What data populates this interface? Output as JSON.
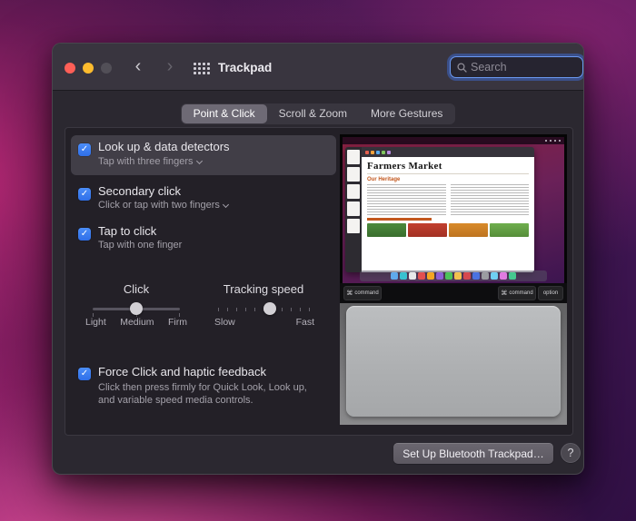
{
  "titlebar": {
    "title": "Trackpad",
    "search_placeholder": "Search"
  },
  "icons": {
    "back": "‹",
    "forward": "›",
    "check": "✓",
    "command_symbol": "⌘"
  },
  "tabs": [
    {
      "label": "Point & Click",
      "selected": true
    },
    {
      "label": "Scroll & Zoom",
      "selected": false
    },
    {
      "label": "More Gestures",
      "selected": false
    }
  ],
  "settings": [
    {
      "label": "Look up & data detectors",
      "detail": "Tap with three fingers",
      "checked": true,
      "has_dropdown": true
    },
    {
      "label": "Secondary click",
      "detail": "Click or tap with two fingers",
      "checked": true,
      "has_dropdown": true
    },
    {
      "label": "Tap to click",
      "detail": "Tap with one finger",
      "checked": true,
      "has_dropdown": false
    },
    {
      "label": "Force Click and haptic feedback",
      "detail": "Click then press firmly for Quick Look, Look up, and variable speed media controls.",
      "checked": true,
      "has_dropdown": false
    }
  ],
  "sliders": {
    "click": {
      "label": "Click",
      "ticks": [
        "Light",
        "Medium",
        "Firm"
      ],
      "value": "Medium"
    },
    "tracking": {
      "label": "Tracking speed",
      "min_label": "Slow",
      "max_label": "Fast"
    }
  },
  "preview": {
    "doc_title": "Farmers Market",
    "doc_heading": "Our Heritage",
    "keys": {
      "left": "command",
      "right1": "command",
      "right2": "option"
    }
  },
  "footer": {
    "setup_button": "Set Up Bluetooth Trackpad…",
    "help": "?"
  },
  "colors": {
    "accent": "#2f6fe8",
    "checkbox": "#3a82f7",
    "focus_ring": "#3e70e6"
  }
}
